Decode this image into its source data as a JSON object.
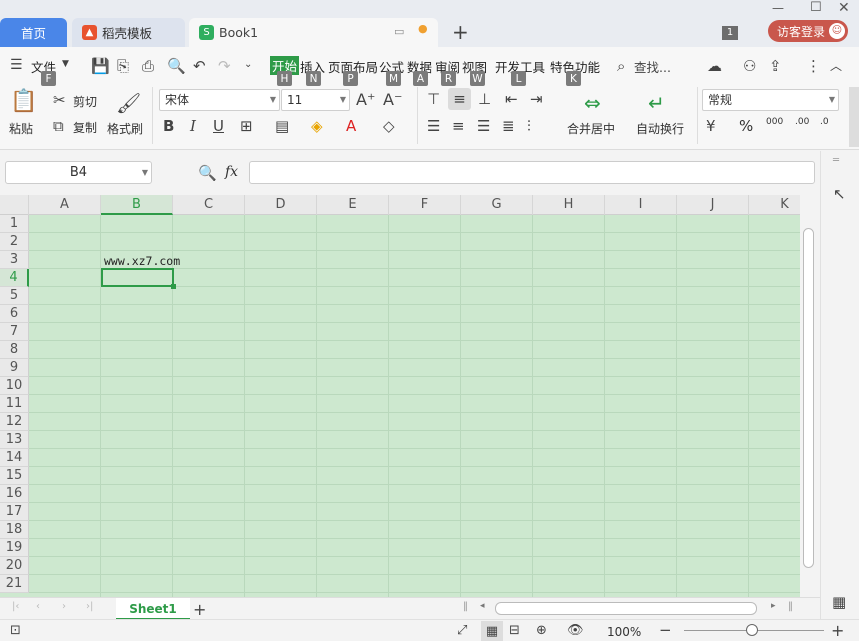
{
  "tabs": {
    "home": "首页",
    "docer": "稻壳模板",
    "book": "Book1"
  },
  "window": {
    "badge": "1",
    "login": "访客登录"
  },
  "menu": {
    "file": "文件",
    "items": [
      "开始",
      "插入",
      "页面布局",
      "公式",
      "数据",
      "审阅",
      "视图",
      "开发工具",
      "特色功能"
    ],
    "search": "查找...",
    "keys": {
      "file": "F",
      "start": "H",
      "insert": "N",
      "layout": "P",
      "formula": "M",
      "data": "A",
      "review": "R",
      "view": "W",
      "dev": "L",
      "special": "K"
    }
  },
  "ribbon": {
    "paste": "粘贴",
    "cut": "剪切",
    "copy": "复制",
    "format_painter": "格式刷",
    "font_name": "宋体",
    "font_size": "11",
    "merge_center": "合并居中",
    "wrap": "自动换行",
    "number_format": "常规",
    "percent": "%",
    "thousands": "000",
    "inc_decimal": ".00",
    "dec_decimal": ".0"
  },
  "formula": {
    "namebox": "B4",
    "fx": "fx",
    "value": ""
  },
  "columns": [
    "A",
    "B",
    "C",
    "D",
    "E",
    "F",
    "G",
    "H",
    "I",
    "J",
    "K"
  ],
  "rows": [
    "1",
    "2",
    "3",
    "4",
    "5",
    "6",
    "7",
    "8",
    "9",
    "10",
    "11",
    "12",
    "13",
    "14",
    "15",
    "16",
    "17",
    "18",
    "19",
    "20",
    "21"
  ],
  "cells": {
    "B3": "www.xz7.com"
  },
  "sheet": {
    "name": "Sheet1"
  },
  "status": {
    "zoom": "100%"
  },
  "colors": {
    "sheet_bg": "#cde8cf",
    "active": "#2e9b48",
    "login": "#c9574c",
    "home_tab": "#4a86e8"
  }
}
